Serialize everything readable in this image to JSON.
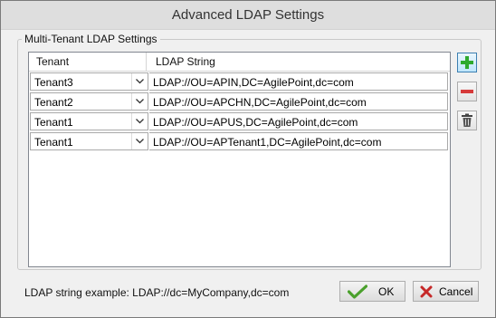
{
  "window": {
    "title": "Advanced LDAP Settings"
  },
  "group": {
    "label": "Multi-Tenant LDAP Settings"
  },
  "grid": {
    "columns": [
      "Tenant",
      "LDAP String"
    ],
    "rows": [
      {
        "tenant": "Tenant3",
        "ldap": "LDAP://OU=APIN,DC=AgilePoint,dc=com"
      },
      {
        "tenant": "Tenant2",
        "ldap": "LDAP://OU=APCHN,DC=AgilePoint,dc=com"
      },
      {
        "tenant": "Tenant1",
        "ldap": "LDAP://OU=APUS,DC=AgilePoint,dc=com"
      },
      {
        "tenant": "Tenant1",
        "ldap": "LDAP://OU=APTenant1,DC=AgilePoint,dc=com"
      }
    ]
  },
  "side_buttons": {
    "add_icon": "plus-icon",
    "remove_icon": "minus-icon",
    "delete_icon": "trash-icon"
  },
  "footer": {
    "example": "LDAP string example: LDAP://dc=MyCompany,dc=com",
    "ok_label": "OK",
    "cancel_label": "Cancel"
  },
  "colors": {
    "add": "#2eaa2e",
    "remove": "#d63a3a",
    "ok_check": "#4aa02c",
    "cancel_x": "#c62828"
  }
}
